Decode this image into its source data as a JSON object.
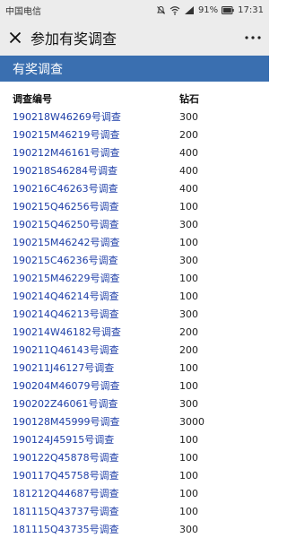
{
  "status": {
    "carrier": "中国电信",
    "battery": "91%",
    "time": "17:31"
  },
  "nav": {
    "title": "参加有奖调查",
    "close_icon": "close-icon",
    "more_icon": "more-icon"
  },
  "section_header": "有奖调查",
  "table": {
    "headers": [
      "调查编号",
      "钻石"
    ],
    "rows": [
      {
        "id": "190218W46269号调查",
        "diamonds": "300"
      },
      {
        "id": "190215M46219号调查",
        "diamonds": "200"
      },
      {
        "id": "190212M46161号调查",
        "diamonds": "400"
      },
      {
        "id": "190218S46284号调查",
        "diamonds": "400"
      },
      {
        "id": "190216C46263号调查",
        "diamonds": "400"
      },
      {
        "id": "190215Q46256号调查",
        "diamonds": "100"
      },
      {
        "id": "190215Q46250号调查",
        "diamonds": "300"
      },
      {
        "id": "190215M46242号调查",
        "diamonds": "100"
      },
      {
        "id": "190215C46236号调查",
        "diamonds": "300"
      },
      {
        "id": "190215M46229号调查",
        "diamonds": "100"
      },
      {
        "id": "190214Q46214号调查",
        "diamonds": "100"
      },
      {
        "id": "190214Q46213号调查",
        "diamonds": "300"
      },
      {
        "id": "190214W46182号调查",
        "diamonds": "200"
      },
      {
        "id": "190211Q46143号调查",
        "diamonds": "200"
      },
      {
        "id": "190211J46127号调查",
        "diamonds": "100"
      },
      {
        "id": "190204M46079号调查",
        "diamonds": "100"
      },
      {
        "id": "190202Z46061号调查",
        "diamonds": "300"
      },
      {
        "id": "190128M45999号调查",
        "diamonds": "3000"
      },
      {
        "id": "190124J45915号调查",
        "diamonds": "100"
      },
      {
        "id": "190122Q45878号调查",
        "diamonds": "100"
      },
      {
        "id": "190117Q45758号调查",
        "diamonds": "100"
      },
      {
        "id": "181212Q44687号调查",
        "diamonds": "100"
      },
      {
        "id": "181115Q43737号调查",
        "diamonds": "100"
      },
      {
        "id": "181115Q43735号调查",
        "diamonds": "300"
      }
    ]
  },
  "colors": {
    "header_blue": "#3a6fb0",
    "link_blue": "#1f3fa8"
  }
}
